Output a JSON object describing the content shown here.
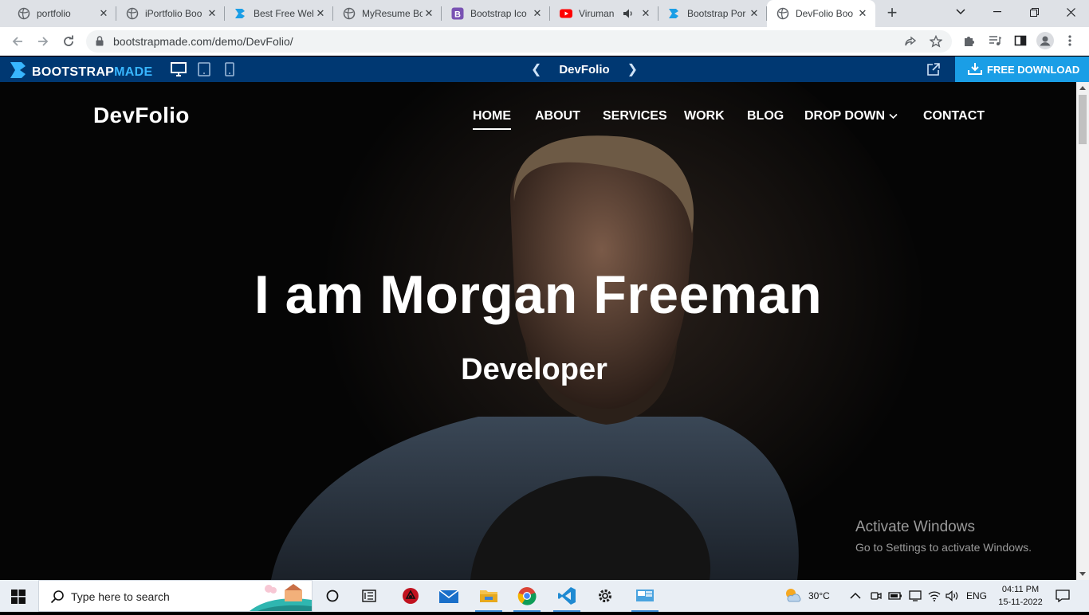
{
  "browser": {
    "tabs": [
      {
        "title": "portfolio",
        "icon": "globe-icon"
      },
      {
        "title": "iPortfolio Boo",
        "icon": "globe-icon"
      },
      {
        "title": "Best Free Wel",
        "icon": "bootstrapmade-icon"
      },
      {
        "title": "MyResume Bo",
        "icon": "globe-icon"
      },
      {
        "title": "Bootstrap Ico",
        "icon": "bootstrap-icon"
      },
      {
        "title": "Viruman",
        "icon": "youtube-icon"
      },
      {
        "title": "Bootstrap Por",
        "icon": "bootstrapmade-icon"
      },
      {
        "title": "DevFolio Boo",
        "icon": "globe-icon"
      }
    ],
    "active_tab": 7,
    "url": "bootstrapmade.com/demo/DevFolio/"
  },
  "demo_bar": {
    "logo_part1": "BOOTSTRAP",
    "logo_part2": "MADE",
    "template_name": "DevFolio",
    "download_label": "FREE DOWNLOAD",
    "accent": "#003872",
    "download_bg": "#1a9ee6"
  },
  "site": {
    "brand": "DevFolio",
    "nav": [
      {
        "label": "HOME",
        "active": true
      },
      {
        "label": "ABOUT"
      },
      {
        "label": "SERVICES"
      },
      {
        "label": "WORK"
      },
      {
        "label": "BLOG"
      },
      {
        "label": "DROP DOWN",
        "dropdown": true
      },
      {
        "label": "CONTACT"
      }
    ],
    "hero_title": "I am Morgan Freeman",
    "hero_subtitle": "Developer"
  },
  "watermark": {
    "line1": "Activate Windows",
    "line2": "Go to Settings to activate Windows."
  },
  "taskbar": {
    "search_placeholder": "Type here to search",
    "weather": "30°C",
    "language": "ENG",
    "time": "04:11 PM",
    "date": "15-11-2022"
  }
}
